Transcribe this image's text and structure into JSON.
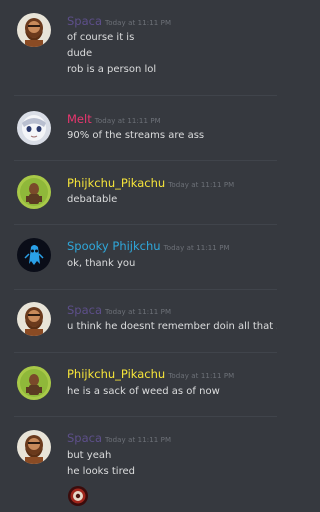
{
  "colors": {
    "background": "#36393f",
    "text": "#dcddde",
    "timestamp": "#6d7178",
    "divider": "#40444b"
  },
  "messages": [
    {
      "author": "Spaca",
      "author_color": "#5d4f8a",
      "avatar_icon": "brown-bearded-character-avatar",
      "timestamp": "Today at 11:11 PM",
      "lines": [
        "of course it is",
        "dude",
        "rob is a person lol"
      ]
    },
    {
      "author": "Melt",
      "author_color": "#e9366f",
      "avatar_icon": "white-anime-character-avatar",
      "timestamp": "Today at 11:11 PM",
      "lines": [
        "90% of the streams are ass"
      ]
    },
    {
      "author": "Phijkchu_Pikachu",
      "author_color": "#f5e43a",
      "avatar_icon": "green-character-avatar",
      "timestamp": "Today at 11:11 PM",
      "lines": [
        "debatable"
      ]
    },
    {
      "author": "Spooky Phijkchu",
      "author_color": "#2fa7da",
      "avatar_icon": "blue-ghost-character-avatar",
      "timestamp": "Today at 11:11 PM",
      "lines": [
        "ok, thank you"
      ]
    },
    {
      "author": "Spaca",
      "author_color": "#5d4f8a",
      "avatar_icon": "brown-bearded-character-avatar",
      "timestamp": "Today at 11:11 PM",
      "lines": [
        "u think he doesnt remember doin all that shit"
      ]
    },
    {
      "author": "Phijkchu_Pikachu",
      "author_color": "#f5e43a",
      "avatar_icon": "green-character-avatar",
      "timestamp": "Today at 11:11 PM",
      "lines": [
        "he is a sack of weed as of now"
      ]
    },
    {
      "author": "Spaca",
      "author_color": "#5d4f8a",
      "avatar_icon": "brown-bearded-character-avatar",
      "timestamp": "Today at 11:11 PM",
      "lines": [
        "but yeah",
        "he looks tired"
      ],
      "reaction_icon": "round-emote-icon"
    }
  ]
}
